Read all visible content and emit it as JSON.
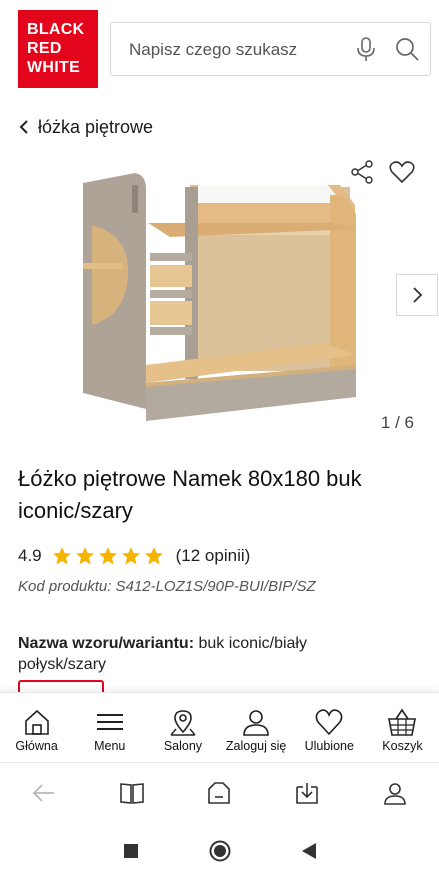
{
  "brand": {
    "logo_lines": [
      "BLACK",
      "RED",
      "WHITE"
    ],
    "color": "#e3051b"
  },
  "search": {
    "placeholder": "Napisz czego szukasz"
  },
  "breadcrumb": {
    "label": "łóżka piętrowe"
  },
  "gallery": {
    "counter": "1 / 6"
  },
  "product": {
    "title": "Łóżko piętrowe Namek 80x180 buk iconic/szary",
    "rating": "4.9",
    "stars": 5,
    "reviews": "(12 opinii)",
    "code": "Kod produktu: S412-LOZ1S/90P-BUI/BIP/SZ",
    "variant_label": "Nazwa wzoru/wariantu:",
    "variant_value": " buk iconic/biały połysk/szary"
  },
  "bottom_nav": {
    "items": [
      {
        "label": "Główna",
        "icon": "home-icon"
      },
      {
        "label": "Menu",
        "icon": "menu-icon"
      },
      {
        "label": "Salony",
        "icon": "map-pin-icon"
      },
      {
        "label": "Zaloguj się",
        "icon": "user-icon"
      },
      {
        "label": "Ulubione",
        "icon": "heart-icon"
      },
      {
        "label": "Koszyk",
        "icon": "basket-icon"
      }
    ]
  },
  "colors": {
    "accent": "#e3051b",
    "star": "#f5b400"
  }
}
